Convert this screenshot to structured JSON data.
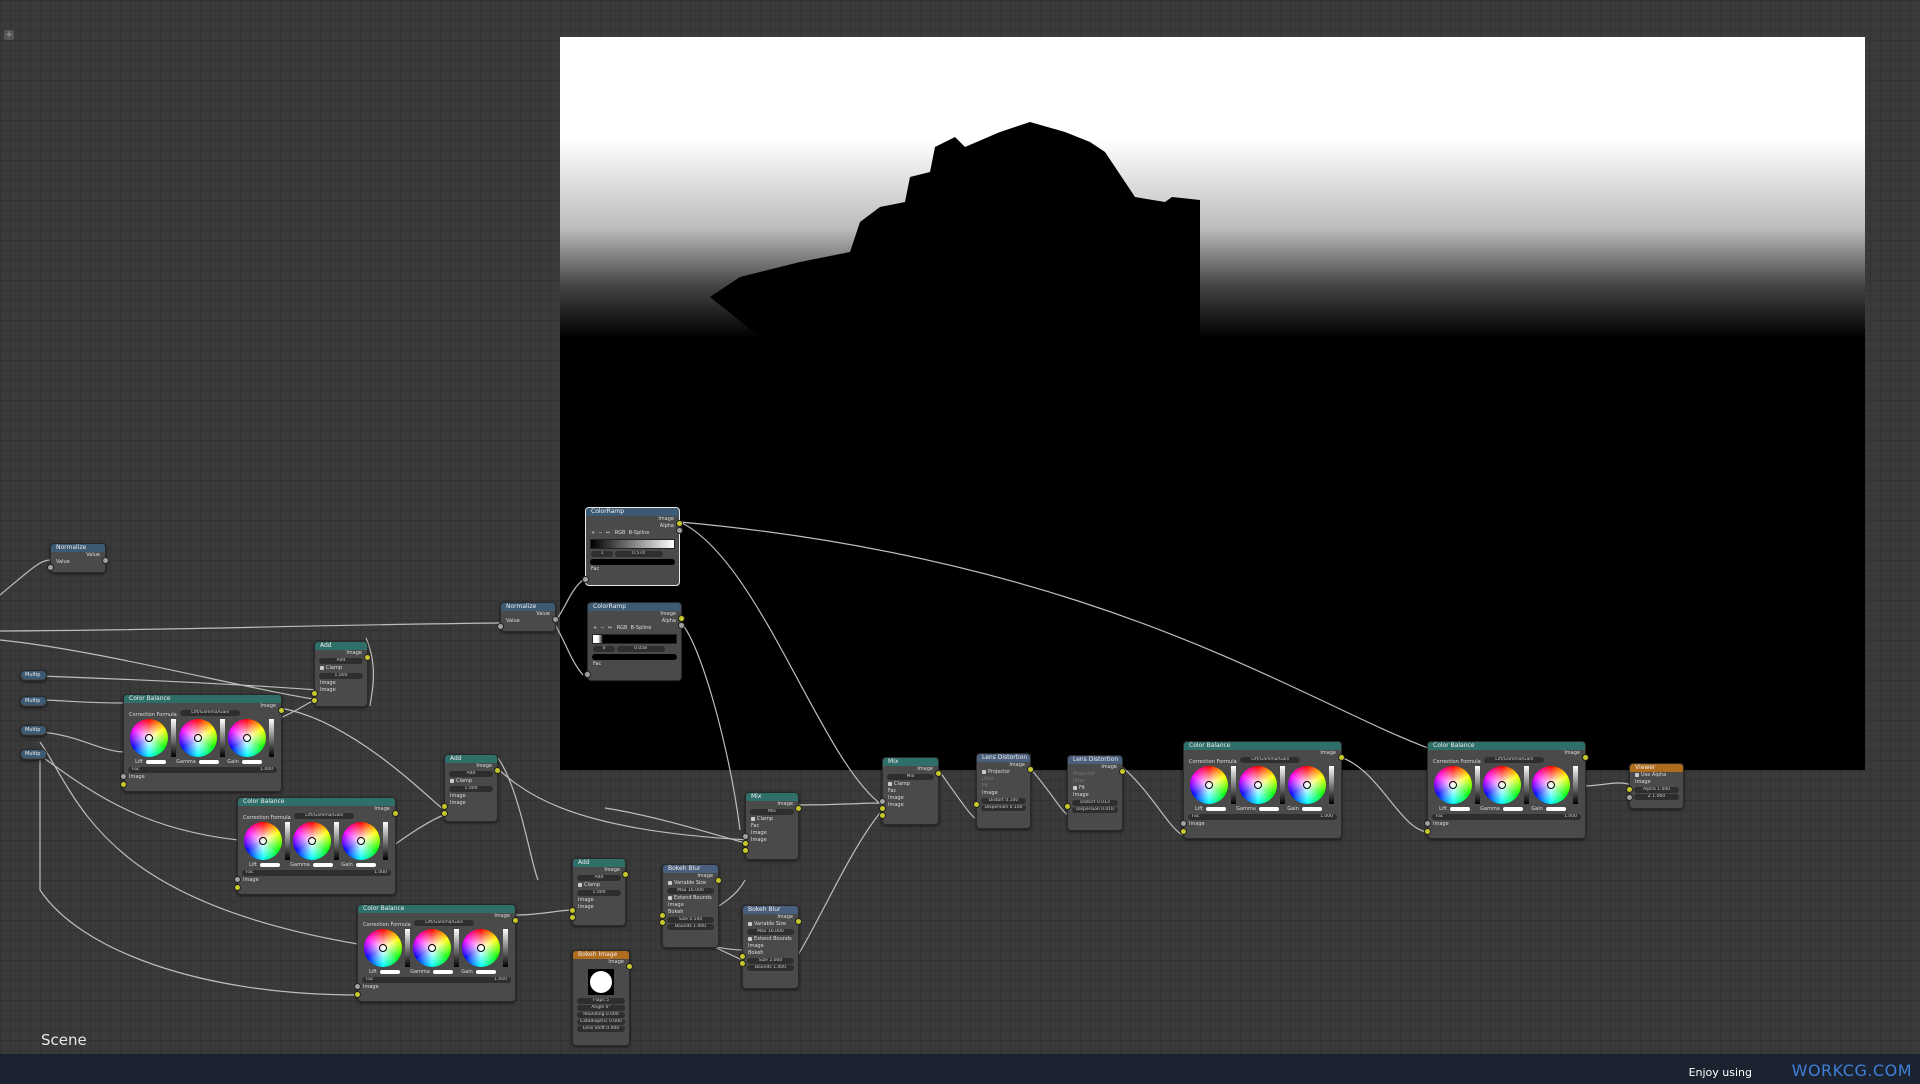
{
  "editor": {
    "add_button": "+",
    "scene_label": "Scene"
  },
  "labels": {
    "image": "Image",
    "alpha": "Alpha",
    "value": "Value",
    "fac": "Fac",
    "clamp": "Clamp",
    "lift": "Lift",
    "gamma": "Gamma",
    "gain": "Gain",
    "correction_formula": "Correction Formula",
    "lgg": "Lift/Gamma/Gain",
    "bokeh": "Bokeh",
    "size": "Size",
    "variable_size": "Variable Size",
    "extend_bounds": "Extend Bounds",
    "projector": "Projector",
    "jitter": "Jitter",
    "fit": "Fit",
    "use_alpha": "Use Alpha",
    "rgb": "RGB",
    "bspline": "B-Spline",
    "add": "Add",
    "mix": "Mix"
  },
  "nodes": {
    "normalize_1": {
      "title": "Normalize"
    },
    "normalize_2": {
      "title": "Normalize"
    },
    "multiply_1": {
      "title": "Multip"
    },
    "multiply_2": {
      "title": "Multip"
    },
    "multiply_3": {
      "title": "Multip"
    },
    "multiply_4": {
      "title": "Multip"
    },
    "color_balance_1": {
      "title": "Color Balance",
      "fac": "1.000"
    },
    "color_balance_2": {
      "title": "Color Balance",
      "fac": "1.000"
    },
    "color_balance_3": {
      "title": "Color Balance",
      "fac": "1.000"
    },
    "color_balance_4": {
      "title": "Color Balance",
      "fac": "1.000"
    },
    "color_balance_5": {
      "title": "Color Balance",
      "fac": "1.000"
    },
    "add_1": {
      "title": "Add",
      "fac": "1.000"
    },
    "add_2": {
      "title": "Add",
      "fac": "1.000"
    },
    "add_3": {
      "title": "Add",
      "fac": "1.000"
    },
    "colorramp_1": {
      "title": "ColorRamp",
      "index": "1",
      "pos": "0.574"
    },
    "colorramp_2": {
      "title": "ColorRamp",
      "index": "0",
      "pos": "0.058"
    },
    "mix_1": {
      "title": "Mix",
      "mode": "Mix"
    },
    "mix_2": {
      "title": "Mix",
      "mode": "Mix"
    },
    "bokeh_blur_1": {
      "title": "Bokeh Blur",
      "max": "Max 16.000",
      "size": "0.500",
      "bounds": "Bounds 1.000"
    },
    "bokeh_blur_2": {
      "title": "Bokeh Blur",
      "max": "Max 16.000",
      "size": "2.000",
      "bounds": "Bounds 1.000"
    },
    "bokeh_image": {
      "title": "Bokeh Image",
      "flaps": "Flaps 5",
      "angle": "Angle 0°",
      "rounding": "Rounding 0.000",
      "catadioptric": "Catadioptric 0.000",
      "lens_shift": "Lens Shift 0.000"
    },
    "lens_distortion_1": {
      "title": "Lens Distortion",
      "distort": "Distort 0.100",
      "dispersion": "Dispersion 0.100"
    },
    "lens_distortion_2": {
      "title": "Lens Distortion",
      "distort": "Distort 0.013",
      "dispersion": "Dispersion 0.010"
    },
    "viewer": {
      "title": "Viewer",
      "alpha": "Alpha 1.000",
      "z": "Z 1.000"
    }
  },
  "footer": {
    "enjoy": "Enjoy using",
    "brand": "WORKCG.COM",
    "bg_color": "#1c2330",
    "brand_color": "#3f7fd8"
  }
}
